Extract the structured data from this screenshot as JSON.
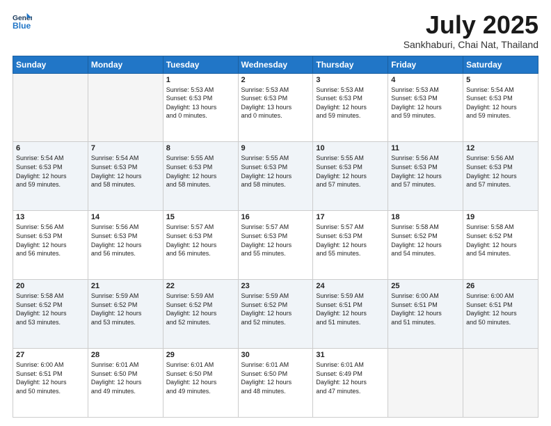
{
  "header": {
    "logo_line1": "General",
    "logo_line2": "Blue",
    "title": "July 2025",
    "subtitle": "Sankhaburi, Chai Nat, Thailand"
  },
  "weekdays": [
    "Sunday",
    "Monday",
    "Tuesday",
    "Wednesday",
    "Thursday",
    "Friday",
    "Saturday"
  ],
  "weeks": [
    [
      {
        "num": "",
        "text": ""
      },
      {
        "num": "",
        "text": ""
      },
      {
        "num": "1",
        "text": "Sunrise: 5:53 AM\nSunset: 6:53 PM\nDaylight: 13 hours\nand 0 minutes."
      },
      {
        "num": "2",
        "text": "Sunrise: 5:53 AM\nSunset: 6:53 PM\nDaylight: 13 hours\nand 0 minutes."
      },
      {
        "num": "3",
        "text": "Sunrise: 5:53 AM\nSunset: 6:53 PM\nDaylight: 12 hours\nand 59 minutes."
      },
      {
        "num": "4",
        "text": "Sunrise: 5:53 AM\nSunset: 6:53 PM\nDaylight: 12 hours\nand 59 minutes."
      },
      {
        "num": "5",
        "text": "Sunrise: 5:54 AM\nSunset: 6:53 PM\nDaylight: 12 hours\nand 59 minutes."
      }
    ],
    [
      {
        "num": "6",
        "text": "Sunrise: 5:54 AM\nSunset: 6:53 PM\nDaylight: 12 hours\nand 59 minutes."
      },
      {
        "num": "7",
        "text": "Sunrise: 5:54 AM\nSunset: 6:53 PM\nDaylight: 12 hours\nand 58 minutes."
      },
      {
        "num": "8",
        "text": "Sunrise: 5:55 AM\nSunset: 6:53 PM\nDaylight: 12 hours\nand 58 minutes."
      },
      {
        "num": "9",
        "text": "Sunrise: 5:55 AM\nSunset: 6:53 PM\nDaylight: 12 hours\nand 58 minutes."
      },
      {
        "num": "10",
        "text": "Sunrise: 5:55 AM\nSunset: 6:53 PM\nDaylight: 12 hours\nand 57 minutes."
      },
      {
        "num": "11",
        "text": "Sunrise: 5:56 AM\nSunset: 6:53 PM\nDaylight: 12 hours\nand 57 minutes."
      },
      {
        "num": "12",
        "text": "Sunrise: 5:56 AM\nSunset: 6:53 PM\nDaylight: 12 hours\nand 57 minutes."
      }
    ],
    [
      {
        "num": "13",
        "text": "Sunrise: 5:56 AM\nSunset: 6:53 PM\nDaylight: 12 hours\nand 56 minutes."
      },
      {
        "num": "14",
        "text": "Sunrise: 5:56 AM\nSunset: 6:53 PM\nDaylight: 12 hours\nand 56 minutes."
      },
      {
        "num": "15",
        "text": "Sunrise: 5:57 AM\nSunset: 6:53 PM\nDaylight: 12 hours\nand 56 minutes."
      },
      {
        "num": "16",
        "text": "Sunrise: 5:57 AM\nSunset: 6:53 PM\nDaylight: 12 hours\nand 55 minutes."
      },
      {
        "num": "17",
        "text": "Sunrise: 5:57 AM\nSunset: 6:53 PM\nDaylight: 12 hours\nand 55 minutes."
      },
      {
        "num": "18",
        "text": "Sunrise: 5:58 AM\nSunset: 6:52 PM\nDaylight: 12 hours\nand 54 minutes."
      },
      {
        "num": "19",
        "text": "Sunrise: 5:58 AM\nSunset: 6:52 PM\nDaylight: 12 hours\nand 54 minutes."
      }
    ],
    [
      {
        "num": "20",
        "text": "Sunrise: 5:58 AM\nSunset: 6:52 PM\nDaylight: 12 hours\nand 53 minutes."
      },
      {
        "num": "21",
        "text": "Sunrise: 5:59 AM\nSunset: 6:52 PM\nDaylight: 12 hours\nand 53 minutes."
      },
      {
        "num": "22",
        "text": "Sunrise: 5:59 AM\nSunset: 6:52 PM\nDaylight: 12 hours\nand 52 minutes."
      },
      {
        "num": "23",
        "text": "Sunrise: 5:59 AM\nSunset: 6:52 PM\nDaylight: 12 hours\nand 52 minutes."
      },
      {
        "num": "24",
        "text": "Sunrise: 5:59 AM\nSunset: 6:51 PM\nDaylight: 12 hours\nand 51 minutes."
      },
      {
        "num": "25",
        "text": "Sunrise: 6:00 AM\nSunset: 6:51 PM\nDaylight: 12 hours\nand 51 minutes."
      },
      {
        "num": "26",
        "text": "Sunrise: 6:00 AM\nSunset: 6:51 PM\nDaylight: 12 hours\nand 50 minutes."
      }
    ],
    [
      {
        "num": "27",
        "text": "Sunrise: 6:00 AM\nSunset: 6:51 PM\nDaylight: 12 hours\nand 50 minutes."
      },
      {
        "num": "28",
        "text": "Sunrise: 6:01 AM\nSunset: 6:50 PM\nDaylight: 12 hours\nand 49 minutes."
      },
      {
        "num": "29",
        "text": "Sunrise: 6:01 AM\nSunset: 6:50 PM\nDaylight: 12 hours\nand 49 minutes."
      },
      {
        "num": "30",
        "text": "Sunrise: 6:01 AM\nSunset: 6:50 PM\nDaylight: 12 hours\nand 48 minutes."
      },
      {
        "num": "31",
        "text": "Sunrise: 6:01 AM\nSunset: 6:49 PM\nDaylight: 12 hours\nand 47 minutes."
      },
      {
        "num": "",
        "text": ""
      },
      {
        "num": "",
        "text": ""
      }
    ]
  ]
}
